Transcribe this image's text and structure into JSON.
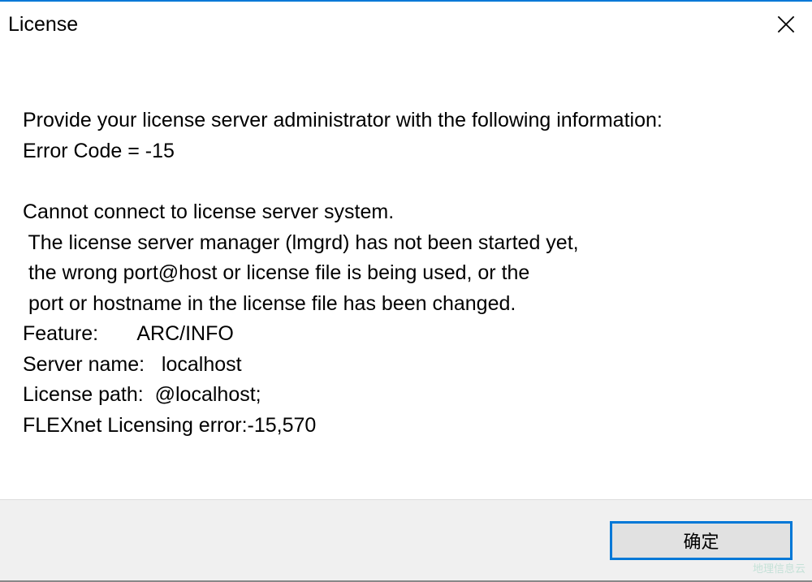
{
  "titlebar": {
    "title": "License"
  },
  "content": {
    "intro": "Provide your license server administrator with the following information:",
    "error_code_label": "Error Code = ",
    "error_code_value": "-15",
    "msg1": "Cannot connect to license server system.",
    "msg2": " The license server manager (lmgrd) has not been started yet,",
    "msg3": " the wrong port@host or license file is being used, or the",
    "msg4": " port or hostname in the license file has been changed.",
    "feature_label": "Feature:       ",
    "feature_value": "ARC/INFO",
    "server_label": "Server name:   ",
    "server_value": "localhost",
    "path_label": "License path:  ",
    "path_value": "@localhost;",
    "flex_label": "FLEXnet Licensing error:",
    "flex_value": "-15,570"
  },
  "footer": {
    "ok_label": "确定"
  },
  "watermark": "地理信息云"
}
